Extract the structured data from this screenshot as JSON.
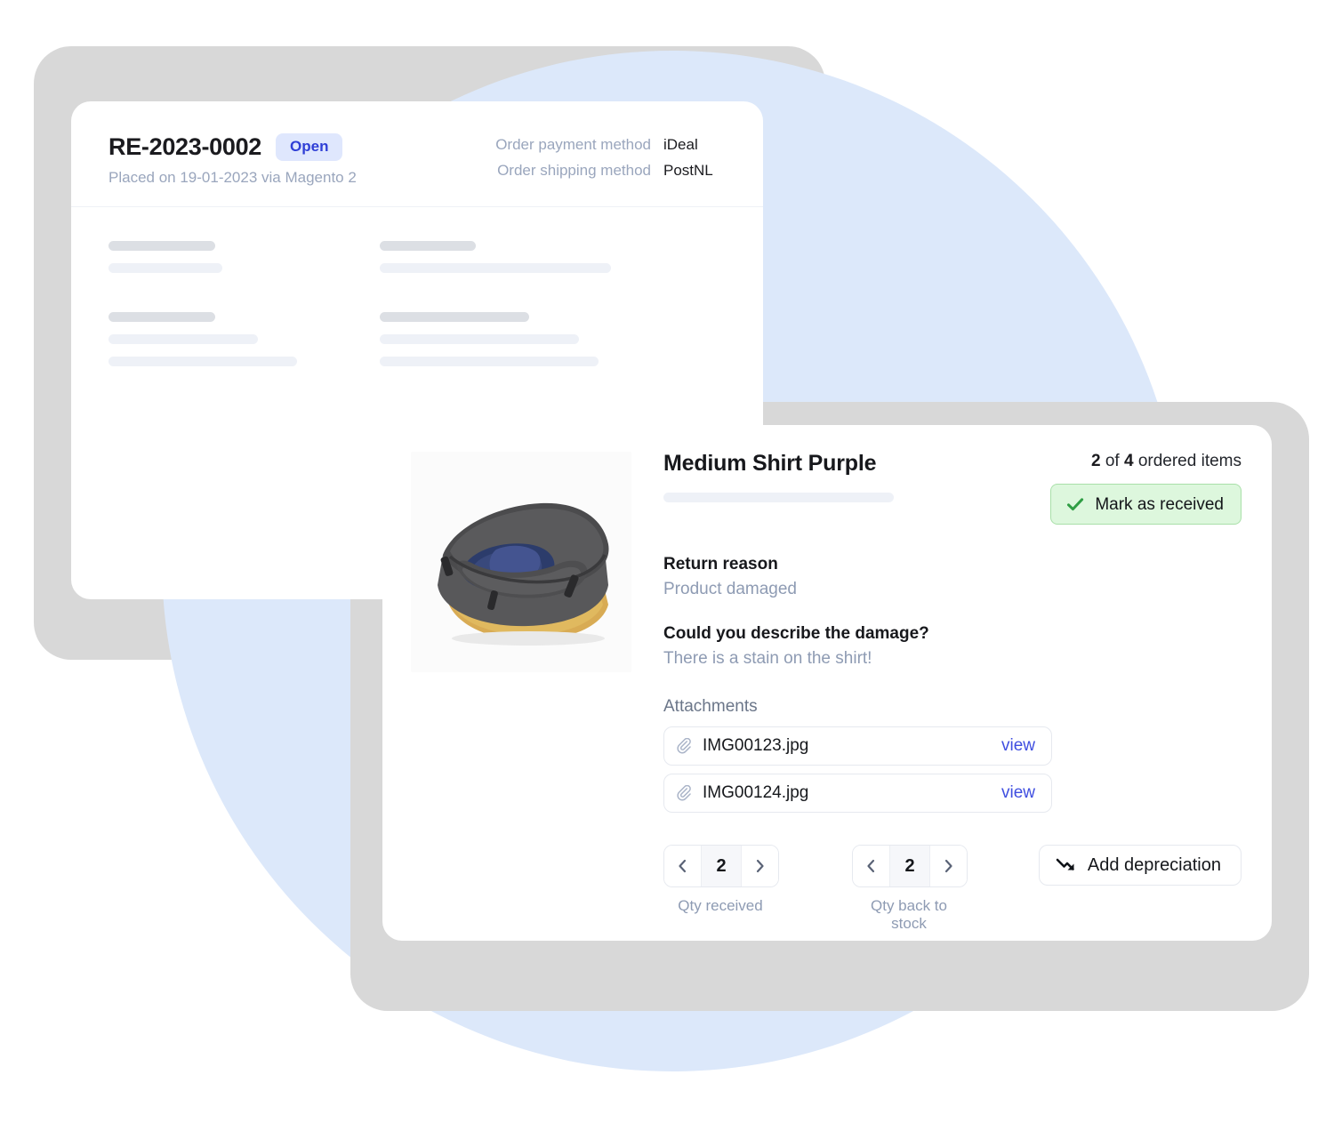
{
  "return_card": {
    "return_id": "RE-2023-0002",
    "status": "Open",
    "placed_line": "Placed on 19-01-2023 via Magento 2",
    "meta": [
      {
        "label": "Order payment method",
        "value": "iDeal"
      },
      {
        "label": "Order shipping method",
        "value": "PostNL"
      }
    ],
    "skeleton": {
      "left": [
        {
          "widths": [
            120,
            128
          ],
          "tones": [
            "dark",
            "light"
          ]
        },
        {
          "widths": [
            120,
            168,
            212
          ],
          "tones": [
            "dark",
            "light",
            "light"
          ]
        }
      ],
      "right": [
        {
          "widths": [
            108,
            260
          ],
          "tones": [
            "dark",
            "light"
          ]
        },
        {
          "widths": [
            168,
            224,
            246
          ],
          "tones": [
            "dark",
            "light",
            "light"
          ]
        }
      ]
    }
  },
  "item_card": {
    "product_title": "Medium Shirt Purple",
    "product_image_alt": "gray-packing-cube-with-blue-shirt",
    "ordered_items": {
      "received_count": "2",
      "separator": "of",
      "total_count": "4",
      "suffix": "ordered items"
    },
    "mark_received_label": "Mark as received",
    "return_reason": {
      "label": "Return reason",
      "value": "Product damaged"
    },
    "damage_question": {
      "label": "Could you describe the damage?",
      "value": "There is a stain on the shirt!"
    },
    "attachments": {
      "title": "Attachments",
      "view_label": "view",
      "files": [
        {
          "name": "IMG00123.jpg"
        },
        {
          "name": "IMG00124.jpg"
        }
      ]
    },
    "steppers": [
      {
        "value": "2",
        "caption": "Qty received",
        "prev": "‹",
        "next": "›"
      },
      {
        "value": "2",
        "caption": "Qty back to stock",
        "prev": "‹",
        "next": "›"
      }
    ],
    "add_depreciation_label": "Add depreciation"
  },
  "colors": {
    "accent_blue": "#3f4ee0",
    "status_pill_bg": "#dfe7fd",
    "status_pill_text": "#2f3fd6",
    "success_bg": "#ddf7dd",
    "success_border": "#a9e0a9",
    "success_check": "#2f9e44",
    "muted_text": "#8e9bb3",
    "backdrop_blue": "#dce8fa",
    "backdrop_gray": "#d8d8d8"
  }
}
